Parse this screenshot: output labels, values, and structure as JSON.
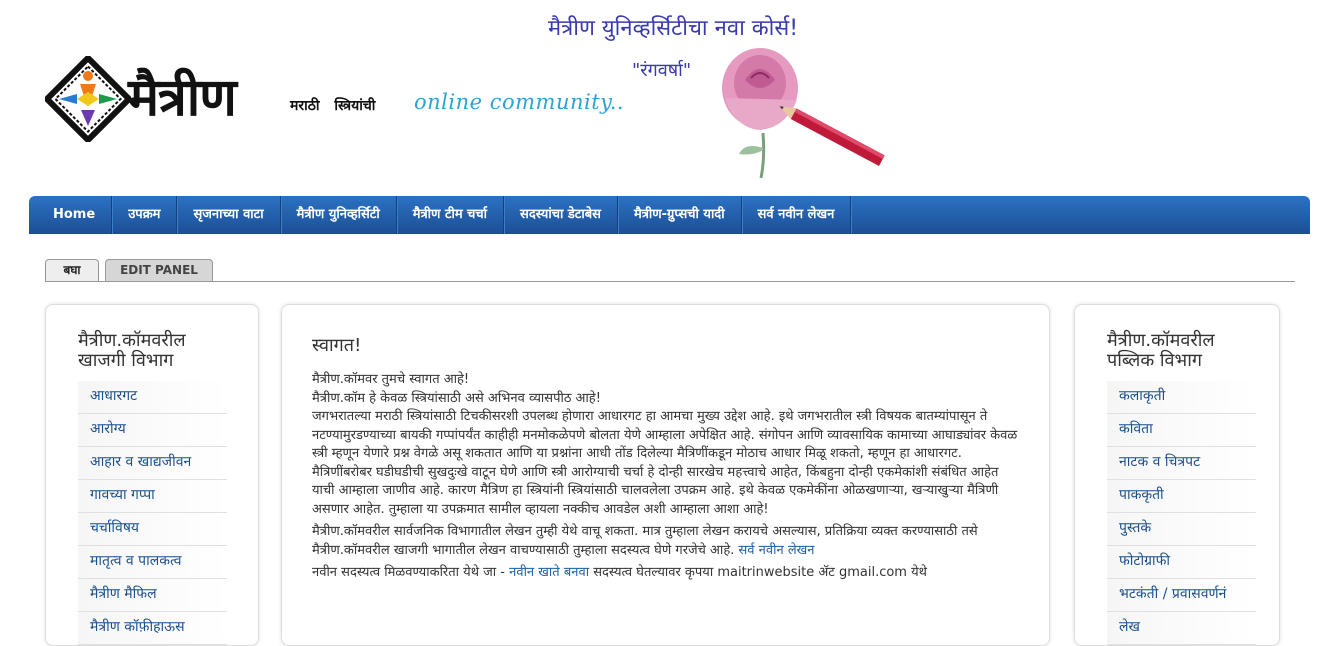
{
  "header": {
    "logo_text": "मैत्रीण",
    "tagline_marathi": "मराठी स्त्रियांची",
    "tagline_online": "online community..",
    "promo_title": "मैत्रीण युनिव्हर्सिटीचा नवा कोर्स!",
    "promo_subtitle": "\"रंगवर्षा\""
  },
  "nav": {
    "items": [
      "Home",
      "उपक्रम",
      "सृजनाच्या वाटा",
      "मैत्रीण युनिव्हर्सिटी",
      "मैत्रीण टीम चर्चा",
      "सदस्यांचा डेटाबेस",
      "मैत्रीण-ग्रुप्सची यादी",
      "सर्व नवीन लेखन"
    ]
  },
  "tabs": {
    "view": "बघा",
    "edit": "EDIT PANEL"
  },
  "left_panel": {
    "title": "मैत्रीण.कॉमवरील खाजगी विभाग",
    "items": [
      "आधारगट",
      "आरोग्य",
      "आहार व खाद्यजीवन",
      "गावच्या गप्पा",
      "चर्चाविषय",
      "मातृत्व व पालकत्व",
      "मैत्रीण मैफिल",
      "मैत्रीण कॉफ़ीहाऊस"
    ]
  },
  "main": {
    "title": "स्वागत!",
    "para1_line1": "मैत्रीण.कॉमवर तुमचे स्वागत आहे!",
    "para1_line2": "मैत्रीण.कॉम हे केवळ स्त्रियांसाठी असे अभिनव व्यासपीठ आहे!",
    "para1_line3": "जगभरातल्या मराठी स्त्रियांसाठी टिचकीसरशी उपलब्ध होणारा आधारगट हा आमचा मुख्य उद्देश आहे. इथे जगभरातील स्त्री विषयक बातम्यांपासून ते नटण्यामुरडण्याच्या बायकी गप्पांपर्यंत काहीही मनमोकळेपणे बोलता येणे आम्हाला अपेक्षित आहे. संगोपन आणि व्यावसायिक कामाच्या आघाड्यांवर केवळ स्त्री म्हणून येणारे प्रश्न वेगळे असू शकतात आणि या प्रश्नांना आधी तोंड दिलेल्या मैत्रिणींकडून मोठाच आधार मिळू शकतो, म्हणून हा आधारगट.",
    "para1_line4": "मैत्रिणींबरोबर घडीघडीची सुखदुःखे वाटून घेणे आणि स्त्री आरोग्याची चर्चा हे दोन्ही सारखेच महत्त्वाचे आहेत, किंबहुना दोन्ही एकमेकांशी संबंधित आहेत याची आम्हाला जाणीव आहे. कारण मैत्रिण हा स्त्रियांनी स्त्रियांसाठी चालवलेला उपक्रम आहे. इथे केवळ एकमेकींना ओळखणाऱ्या, खऱ्याखुऱ्या मैत्रिणी असणार आहेत. तुम्हाला या उपक्रमात सामील व्हायला नक्कीच आवडेल अशी आम्हाला आशा आहे!",
    "para2": "मैत्रीण.कॉमवरील सार्वजनिक विभागातील लेखन तुम्ही येथे वाचू शकता. मात्र तुम्हाला लेखन करायचे असल्यास, प्रतिक्रिया व्यक्त करण्यासाठी तसे मैत्रीण.कॉमवरील खाजगी भागातील लेखन वाचण्यासाठी तुम्हाला सदस्यत्व घेणे गरजेचे आहे.",
    "para2_link": "सर्व नवीन लेखन",
    "para3_prefix": "नवीन सदस्यत्व मिळवण्याकरिता येथे जा -",
    "para3_link": "नवीन खाते बनवा",
    "para3_suffix": "सदस्यत्व घेतल्यावर कृपया maitrinwebsite ॲट gmail.com येथे"
  },
  "right_panel": {
    "title": "मैत्रीण.कॉमवरील पब्लिक विभाग",
    "items": [
      "कलाकृती",
      "कविता",
      "नाटक व चित्रपट",
      "पाककृती",
      "पुस्तके",
      "फोटोग्राफी",
      "भटकंती / प्रवासवर्णनं",
      "लेख"
    ]
  },
  "colors": {
    "nav_bg": "#1f5aa6",
    "link": "#1a5fa6",
    "promo": "#3a3ab0",
    "online_tag": "#2aa4d6"
  }
}
